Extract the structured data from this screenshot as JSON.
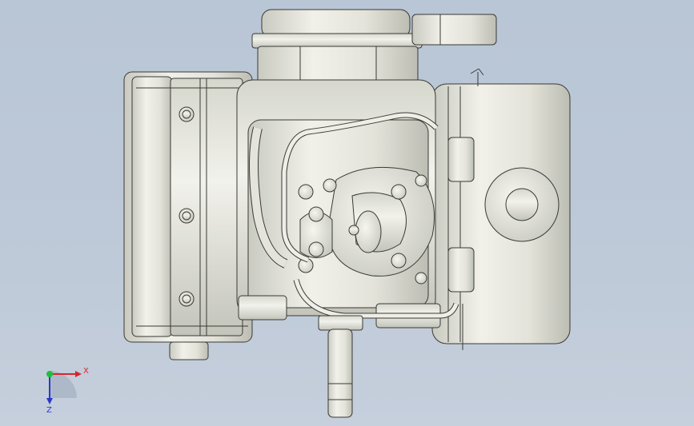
{
  "app": {
    "view": "3d-model-viewport"
  },
  "model": {
    "subject": "engine-assembly",
    "render_style": "shaded-with-edges"
  },
  "triad": {
    "x_label": "X",
    "z_label": "Z",
    "colors": {
      "x": "#d8262a",
      "y": "#1fbf3a",
      "z": "#2a39c8"
    }
  },
  "colors": {
    "background_top": "#b9c6d6",
    "background_bottom": "#c6cfdc",
    "part_fill": "#e8e8e0",
    "part_shade": "#cfd0c6",
    "edge": "#3a3a36"
  }
}
